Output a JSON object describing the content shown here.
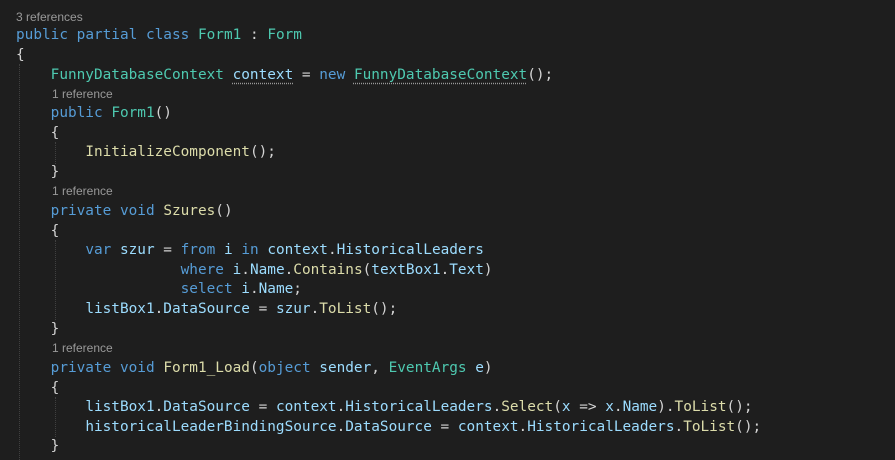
{
  "editor": {
    "language": "csharp",
    "colors": {
      "background": "#1e1e1e",
      "keyword": "#569cd6",
      "control_keyword": "#c586c0",
      "type": "#4ec9b0",
      "method": "#dcdcaa",
      "variable": "#9cdcfe",
      "plain": "#d4d4d4",
      "code_lens": "#999999",
      "indent_guide": "#404040"
    },
    "code_lens": [
      {
        "id": "lens-class",
        "text": "3 references"
      },
      {
        "id": "lens-ctor",
        "text": "1 reference"
      },
      {
        "id": "lens-szures",
        "text": "1 reference"
      },
      {
        "id": "lens-form1load",
        "text": "1 reference"
      }
    ],
    "lines": [
      {
        "lens": 0,
        "tokens": []
      },
      {
        "tokens": [
          {
            "t": "public",
            "c": "keyword"
          },
          {
            "t": " ",
            "c": "plain"
          },
          {
            "t": "partial",
            "c": "keyword"
          },
          {
            "t": " ",
            "c": "plain"
          },
          {
            "t": "class",
            "c": "keyword"
          },
          {
            "t": " ",
            "c": "plain"
          },
          {
            "t": "Form1",
            "c": "type"
          },
          {
            "t": " : ",
            "c": "plain"
          },
          {
            "t": "Form",
            "c": "type"
          }
        ]
      },
      {
        "tokens": [
          {
            "t": "{",
            "c": "plain"
          }
        ]
      },
      {
        "tokens": [
          {
            "t": "    ",
            "c": "plain"
          },
          {
            "t": "FunnyDatabaseContext",
            "c": "type"
          },
          {
            "t": " ",
            "c": "plain"
          },
          {
            "t": "context",
            "c": "variable",
            "dots": true
          },
          {
            "t": " = ",
            "c": "plain"
          },
          {
            "t": "new",
            "c": "keyword"
          },
          {
            "t": " ",
            "c": "plain"
          },
          {
            "t": "FunnyDatabaseContext",
            "c": "type",
            "dots": true
          },
          {
            "t": "();",
            "c": "plain"
          }
        ]
      },
      {
        "lens": 1,
        "tokens": []
      },
      {
        "tokens": [
          {
            "t": "    ",
            "c": "plain"
          },
          {
            "t": "public",
            "c": "keyword"
          },
          {
            "t": " ",
            "c": "plain"
          },
          {
            "t": "Form1",
            "c": "type"
          },
          {
            "t": "()",
            "c": "plain"
          }
        ]
      },
      {
        "tokens": [
          {
            "t": "    {",
            "c": "plain"
          }
        ]
      },
      {
        "tokens": [
          {
            "t": "        ",
            "c": "plain"
          },
          {
            "t": "InitializeComponent",
            "c": "method"
          },
          {
            "t": "();",
            "c": "plain"
          }
        ]
      },
      {
        "tokens": [
          {
            "t": "    }",
            "c": "plain"
          }
        ]
      },
      {
        "lens": 2,
        "tokens": []
      },
      {
        "tokens": [
          {
            "t": "    ",
            "c": "plain"
          },
          {
            "t": "private",
            "c": "keyword"
          },
          {
            "t": " ",
            "c": "plain"
          },
          {
            "t": "void",
            "c": "keyword"
          },
          {
            "t": " ",
            "c": "plain"
          },
          {
            "t": "Szures",
            "c": "method"
          },
          {
            "t": "()",
            "c": "plain"
          }
        ]
      },
      {
        "tokens": [
          {
            "t": "    {",
            "c": "plain"
          }
        ]
      },
      {
        "tokens": [
          {
            "t": "        ",
            "c": "plain"
          },
          {
            "t": "var",
            "c": "keyword"
          },
          {
            "t": " ",
            "c": "plain"
          },
          {
            "t": "szur",
            "c": "variable"
          },
          {
            "t": " = ",
            "c": "plain"
          },
          {
            "t": "from",
            "c": "keyword"
          },
          {
            "t": " ",
            "c": "plain"
          },
          {
            "t": "i",
            "c": "variable"
          },
          {
            "t": " ",
            "c": "plain"
          },
          {
            "t": "in",
            "c": "keyword"
          },
          {
            "t": " ",
            "c": "plain"
          },
          {
            "t": "context",
            "c": "variable"
          },
          {
            "t": ".",
            "c": "plain"
          },
          {
            "t": "HistoricalLeaders",
            "c": "variable"
          }
        ]
      },
      {
        "tokens": [
          {
            "t": "                   ",
            "c": "plain"
          },
          {
            "t": "where",
            "c": "keyword"
          },
          {
            "t": " ",
            "c": "plain"
          },
          {
            "t": "i",
            "c": "variable"
          },
          {
            "t": ".",
            "c": "plain"
          },
          {
            "t": "Name",
            "c": "variable"
          },
          {
            "t": ".",
            "c": "plain"
          },
          {
            "t": "Contains",
            "c": "method"
          },
          {
            "t": "(",
            "c": "plain"
          },
          {
            "t": "textBox1",
            "c": "variable"
          },
          {
            "t": ".",
            "c": "plain"
          },
          {
            "t": "Text",
            "c": "variable"
          },
          {
            "t": ")",
            "c": "plain"
          }
        ]
      },
      {
        "tokens": [
          {
            "t": "                   ",
            "c": "plain"
          },
          {
            "t": "select",
            "c": "keyword"
          },
          {
            "t": " ",
            "c": "plain"
          },
          {
            "t": "i",
            "c": "variable"
          },
          {
            "t": ".",
            "c": "plain"
          },
          {
            "t": "Name",
            "c": "variable"
          },
          {
            "t": ";",
            "c": "plain"
          }
        ]
      },
      {
        "tokens": [
          {
            "t": "        ",
            "c": "plain"
          },
          {
            "t": "listBox1",
            "c": "variable"
          },
          {
            "t": ".",
            "c": "plain"
          },
          {
            "t": "DataSource",
            "c": "variable"
          },
          {
            "t": " = ",
            "c": "plain"
          },
          {
            "t": "szur",
            "c": "variable"
          },
          {
            "t": ".",
            "c": "plain"
          },
          {
            "t": "ToList",
            "c": "method"
          },
          {
            "t": "();",
            "c": "plain"
          }
        ]
      },
      {
        "tokens": [
          {
            "t": "    }",
            "c": "plain"
          }
        ]
      },
      {
        "lens": 3,
        "tokens": []
      },
      {
        "tokens": [
          {
            "t": "    ",
            "c": "plain"
          },
          {
            "t": "private",
            "c": "keyword"
          },
          {
            "t": " ",
            "c": "plain"
          },
          {
            "t": "void",
            "c": "keyword"
          },
          {
            "t": " ",
            "c": "plain"
          },
          {
            "t": "Form1_Load",
            "c": "method"
          },
          {
            "t": "(",
            "c": "plain"
          },
          {
            "t": "object",
            "c": "keyword"
          },
          {
            "t": " ",
            "c": "plain"
          },
          {
            "t": "sender",
            "c": "variable"
          },
          {
            "t": ", ",
            "c": "plain"
          },
          {
            "t": "EventArgs",
            "c": "type"
          },
          {
            "t": " ",
            "c": "plain"
          },
          {
            "t": "e",
            "c": "variable"
          },
          {
            "t": ")",
            "c": "plain"
          }
        ]
      },
      {
        "tokens": [
          {
            "t": "    {",
            "c": "plain"
          }
        ]
      },
      {
        "tokens": [
          {
            "t": "        ",
            "c": "plain"
          },
          {
            "t": "listBox1",
            "c": "variable"
          },
          {
            "t": ".",
            "c": "plain"
          },
          {
            "t": "DataSource",
            "c": "variable"
          },
          {
            "t": " = ",
            "c": "plain"
          },
          {
            "t": "context",
            "c": "variable"
          },
          {
            "t": ".",
            "c": "plain"
          },
          {
            "t": "HistoricalLeaders",
            "c": "variable"
          },
          {
            "t": ".",
            "c": "plain"
          },
          {
            "t": "Select",
            "c": "method"
          },
          {
            "t": "(",
            "c": "plain"
          },
          {
            "t": "x",
            "c": "variable"
          },
          {
            "t": " => ",
            "c": "plain"
          },
          {
            "t": "x",
            "c": "variable"
          },
          {
            "t": ".",
            "c": "plain"
          },
          {
            "t": "Name",
            "c": "variable"
          },
          {
            "t": ").",
            "c": "plain"
          },
          {
            "t": "ToList",
            "c": "method"
          },
          {
            "t": "();",
            "c": "plain"
          }
        ]
      },
      {
        "tokens": [
          {
            "t": "        ",
            "c": "plain"
          },
          {
            "t": "historicalLeaderBindingSource",
            "c": "variable"
          },
          {
            "t": ".",
            "c": "plain"
          },
          {
            "t": "DataSource",
            "c": "variable"
          },
          {
            "t": " = ",
            "c": "plain"
          },
          {
            "t": "context",
            "c": "variable"
          },
          {
            "t": ".",
            "c": "plain"
          },
          {
            "t": "HistoricalLeaders",
            "c": "variable"
          },
          {
            "t": ".",
            "c": "plain"
          },
          {
            "t": "ToList",
            "c": "method"
          },
          {
            "t": "();",
            "c": "plain"
          }
        ]
      },
      {
        "tokens": [
          {
            "t": "    }",
            "c": "plain"
          }
        ]
      }
    ]
  }
}
